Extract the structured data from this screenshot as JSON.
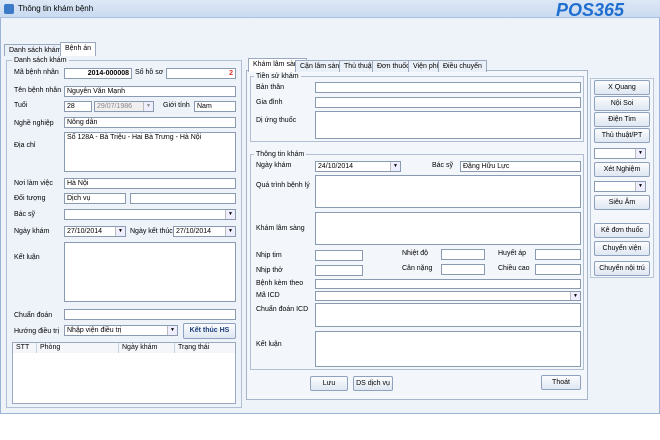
{
  "window": {
    "title": "Thông tin khám bệnh"
  },
  "brand": {
    "logo": "POS365"
  },
  "main_tabs": [
    "Danh sách khám",
    "Bệnh án"
  ],
  "left": {
    "group_title": "Danh sách khám",
    "ma_benh_nhan_label": "Mã bệnh nhân",
    "ma_benh_nhan": "2014-000008",
    "so_ho_so_label": "Số hồ sơ",
    "so_ho_so": "2",
    "ten_label": "Tên bệnh nhân",
    "ten": "Nguyễn Văn Mạnh",
    "tuoi_label": "Tuổi",
    "tuoi": "28",
    "ngay_sinh": "29/07/1986",
    "gioi_tinh_label": "Giới tính",
    "gioi_tinh": "Nam",
    "nghe_label": "Nghề nghiệp",
    "nghe": "Nông dân",
    "dia_chi_label": "Địa chỉ",
    "dia_chi": "Số 128A - Bà Triệu - Hai Bà Trưng - Hà Nội",
    "noi_lam_label": "Nơi làm việc",
    "noi_lam": "Hà Nội",
    "doi_tuong_label": "Đối tượng",
    "doi_tuong": "Dịch vụ",
    "bac_si_label": "Bác sỹ",
    "ngay_kham_label": "Ngày khám",
    "ngay_kham": "27/10/2014",
    "ngay_ket_thuc_label": "Ngày kết thúc",
    "ngay_ket_thuc": "27/10/2014",
    "ket_luan_label": "Kết luận",
    "chuan_doan_label": "Chuẩn đoán",
    "huong_label": "Hướng điều trị",
    "huong": "Nhập viện điều trị",
    "ket_thuc_btn": "Kết thúc HS",
    "table_headers": [
      "STT",
      "Phòng",
      "Ngày khám",
      "Trạng thái"
    ]
  },
  "sub_tabs": [
    "Khám lâm sàng",
    "Cận lâm sàng",
    "Thủ thuật",
    "Đơn thuốc",
    "Viện phí",
    "Điều chuyển"
  ],
  "tien_su": {
    "title": "Tiền sử khám",
    "ban_than": "Bản thân",
    "gia_dinh": "Gia đình",
    "di_ung": "Dị ứng thuốc"
  },
  "thong_tin": {
    "title": "Thông tin khám",
    "ngay_kham_label": "Ngày khám",
    "ngay_kham": "24/10/2014",
    "bac_si_label": "Bác sỹ",
    "bac_si": "Đặng Hữu Lực",
    "qua_trinh": "Quá trình bệnh lý",
    "kham_lam_sang": "Khám lâm sàng",
    "nhip_tim": "Nhịp tim",
    "nhiet_do": "Nhiệt độ",
    "huyet_ap": "Huyết áp",
    "nhip_tho": "Nhịp thở",
    "can_nang": "Cân nặng",
    "chieu_cao": "Chiều cao",
    "benh_kem": "Bệnh kèm theo",
    "ma_icd": "Mã ICD",
    "chuan_doan_icd": "Chuẩn đoán ICD",
    "ket_luan": "Kết luận"
  },
  "bottom_buttons": {
    "luu": "Lưu",
    "ds_dich_vu": "DS dịch vụ",
    "thoat": "Thoát"
  },
  "side_buttons": {
    "x_quang": "X Quang",
    "noi_soi": "Nội Soi",
    "dien_tim": "Điện Tim",
    "thu_thuat": "Thủ thuật/PT",
    "xet_nghiem": "Xét Nghiệm",
    "sieu_am": "Siêu Âm",
    "ke_don": "Kê đơn thuốc",
    "chuyen_vien": "Chuyển viện",
    "chuyen_noi_tru": "Chuyển nội trú"
  },
  "colors": {
    "accent_red": "#e0302a",
    "logo_blue": "#1f6fd1"
  }
}
